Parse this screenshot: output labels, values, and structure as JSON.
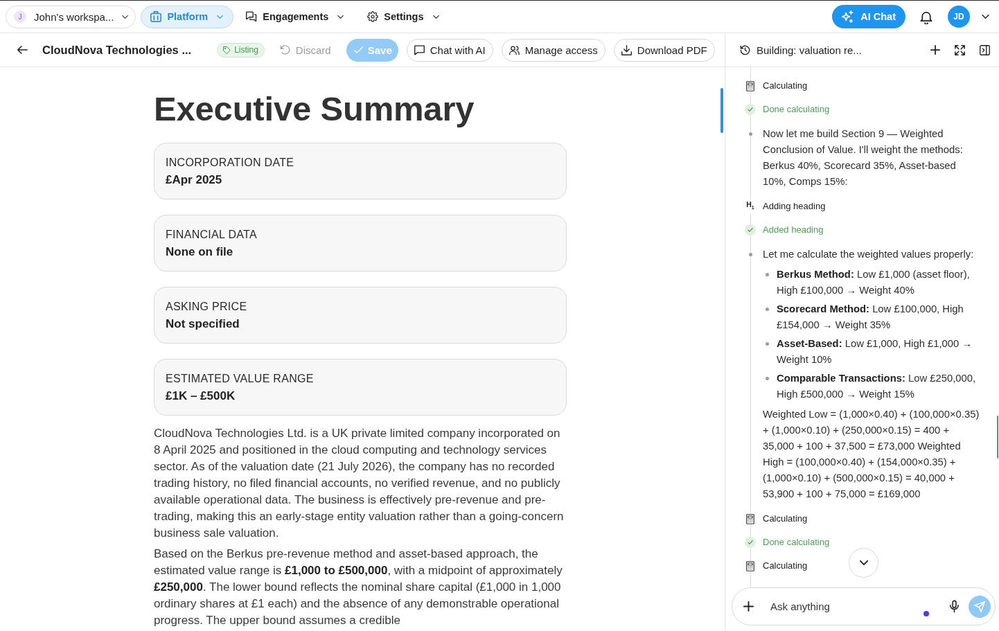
{
  "top_nav": {
    "workspace": {
      "avatar": "J",
      "name": "John's workspa..."
    },
    "items": [
      {
        "label": "Platform",
        "selected": true
      },
      {
        "label": "Engagements",
        "selected": false
      },
      {
        "label": "Settings",
        "selected": false
      }
    ],
    "ai_chat_button": "AI Chat",
    "user_avatar": "JD"
  },
  "document_bar": {
    "title": "CloudNova Technologies ...",
    "tag": "Listing",
    "actions": [
      {
        "kind": "plain",
        "label": "Discard",
        "disabled": true
      },
      {
        "kind": "primary",
        "label": "Save",
        "disabled": true
      },
      {
        "kind": "outline",
        "label": "Chat with AI",
        "disabled": false
      },
      {
        "kind": "outline",
        "label": "Manage access",
        "disabled": false
      },
      {
        "kind": "outline",
        "label": "Download PDF",
        "disabled": false
      }
    ]
  },
  "document": {
    "heading": "Executive Summary",
    "summary_cards": [
      {
        "label": "INCORPORATION DATE",
        "value": "£Apr 2025"
      },
      {
        "label": "FINANCIAL DATA",
        "value": "None on file"
      },
      {
        "label": "ASKING PRICE",
        "value": "Not specified"
      },
      {
        "label": "ESTIMATED VALUE RANGE",
        "value": "£1K – £500K"
      }
    ],
    "paragraphs": [
      "CloudNova Technologies Ltd. is a UK private limited company incorporated on 8 April 2025 and positioned in the cloud computing and technology services sector. As of the valuation date (21 July 2026), the company has no recorded trading history, no filed financial accounts, no verified revenue, and no publicly available operational data. The business is effectively pre-revenue and pre-trading, making this an early-stage entity valuation rather than a going-concern business sale valuation.",
      "Based on the Berkus pre-revenue method and asset-based approach, the estimated value range is **£1,000 to £500,000**, with a midpoint of approximately **£250,000**. The lower bound reflects the nominal share capital (£1,000 in 1,000 ordinary shares at £1 each) and the absence of any demonstrable operational progress. The upper bound assumes a credible"
    ]
  },
  "chat_panel": {
    "title": "Building: valuation re...",
    "steps": [
      {
        "kind": "tool",
        "label": "Calculating"
      },
      {
        "kind": "done",
        "label": "Done calculating"
      },
      {
        "kind": "message",
        "text": "Now let me build Section 9 — Weighted Conclusion of Value. I'll weight the methods: Berkus 40%, Scorecard 35%, Asset-based 10%, Comps 15%:"
      },
      {
        "kind": "heading",
        "marker": "H$_{1}$",
        "label": "Adding heading"
      },
      {
        "kind": "done",
        "label": "Added heading"
      },
      {
        "kind": "message",
        "text": "Let me calculate the weighted values properly:",
        "bullets": [
          "**Berkus Method:** Low £1,000 (asset floor), High £100,000 → Weight 40%",
          "**Scorecard Method:** Low £100,000, High £154,000 → Weight 35%",
          "**Asset-Based:** Low £1,000, High £1,000 → Weight 10%",
          "**Comparable Transactions:** Low £250,000, High £500,000 → Weight 15%"
        ],
        "followup": "Weighted Low = (1,000×0.40) + (100,000×0.35) + (1,000×0.10) + (250,000×0.15) = 400 + 35,000 + 100 + 37,500 = £73,000 Weighted High = (100,000×0.40) + (154,000×0.35) + (1,000×0.10) + (500,000×0.15) = 40,000 + 53,900 + 100 + 75,000 = £169,000"
      },
      {
        "kind": "tool",
        "label": "Calculating"
      },
      {
        "kind": "done",
        "label": "Done calculating"
      },
      {
        "kind": "tool",
        "label": "Calculating"
      }
    ],
    "input": {
      "placeholder": "Ask anything"
    }
  }
}
